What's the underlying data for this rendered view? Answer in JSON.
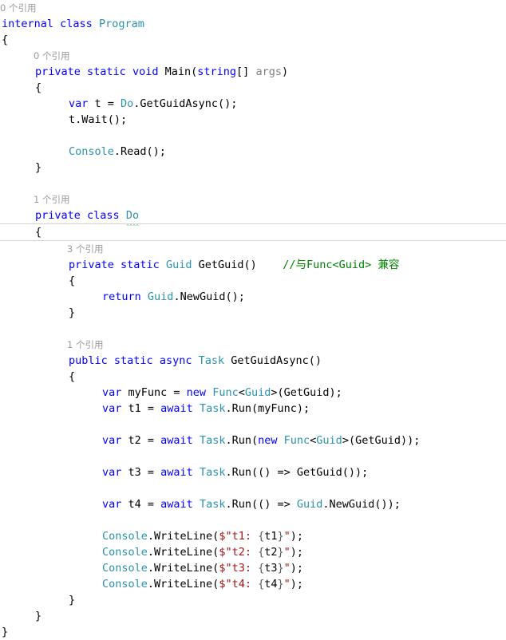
{
  "editor": {
    "language": "csharp",
    "theme": "light",
    "background": "#ffffff",
    "colors": {
      "keyword": "#0000ff",
      "type": "#2b91af",
      "comment": "#008000",
      "string": "#a31515",
      "parameter": "#808080",
      "codelens": "#9a9a9a",
      "squiggle": "#3bb371",
      "current_line_border": "#d4d4d4",
      "text": "#000000"
    }
  },
  "lines": [
    {
      "id": "l00",
      "kind": "clipped",
      "indent": 0,
      "tokens": [
        {
          "t": "0 个引用",
          "c": "codelens"
        }
      ]
    },
    {
      "id": "l01",
      "kind": "code",
      "indent": 0,
      "tokens": [
        {
          "t": "internal",
          "c": "kw"
        },
        {
          "t": " ",
          "c": "plain"
        },
        {
          "t": "class",
          "c": "kw"
        },
        {
          "t": " ",
          "c": "plain"
        },
        {
          "t": "Program",
          "c": "type"
        }
      ]
    },
    {
      "id": "l02",
      "kind": "code",
      "indent": 0,
      "tokens": [
        {
          "t": "{",
          "c": "plain"
        }
      ]
    },
    {
      "id": "l03",
      "kind": "codelens",
      "indent": 1,
      "tokens": [
        {
          "t": "0 个引用",
          "c": "codelens"
        }
      ]
    },
    {
      "id": "l04",
      "kind": "code",
      "indent": 1,
      "tokens": [
        {
          "t": "private",
          "c": "kw"
        },
        {
          "t": " ",
          "c": "plain"
        },
        {
          "t": "static",
          "c": "kw"
        },
        {
          "t": " ",
          "c": "plain"
        },
        {
          "t": "void",
          "c": "kw"
        },
        {
          "t": " Main(",
          "c": "plain"
        },
        {
          "t": "string",
          "c": "kw"
        },
        {
          "t": "[] ",
          "c": "plain"
        },
        {
          "t": "args",
          "c": "param"
        },
        {
          "t": ")",
          "c": "plain"
        }
      ]
    },
    {
      "id": "l05",
      "kind": "code",
      "indent": 1,
      "tokens": [
        {
          "t": "{",
          "c": "plain"
        }
      ]
    },
    {
      "id": "l06",
      "kind": "code",
      "indent": 2,
      "tokens": [
        {
          "t": "var",
          "c": "kw"
        },
        {
          "t": " t = ",
          "c": "plain"
        },
        {
          "t": "Do",
          "c": "type"
        },
        {
          "t": ".GetGuidAsync();",
          "c": "plain"
        }
      ]
    },
    {
      "id": "l07",
      "kind": "code",
      "indent": 2,
      "tokens": [
        {
          "t": "t.Wait();",
          "c": "plain"
        }
      ]
    },
    {
      "id": "l08",
      "kind": "code",
      "indent": 0,
      "tokens": []
    },
    {
      "id": "l09",
      "kind": "code",
      "indent": 2,
      "tokens": [
        {
          "t": "Console",
          "c": "type"
        },
        {
          "t": ".Read();",
          "c": "plain"
        }
      ]
    },
    {
      "id": "l10",
      "kind": "code",
      "indent": 1,
      "tokens": [
        {
          "t": "}",
          "c": "plain"
        }
      ]
    },
    {
      "id": "l11",
      "kind": "code",
      "indent": 0,
      "tokens": []
    },
    {
      "id": "l12",
      "kind": "codelens",
      "indent": 1,
      "tokens": [
        {
          "t": "1 个引用",
          "c": "codelens"
        }
      ]
    },
    {
      "id": "l13",
      "kind": "code",
      "indent": 1,
      "tokens": [
        {
          "t": "private",
          "c": "kw"
        },
        {
          "t": " ",
          "c": "plain"
        },
        {
          "t": "class",
          "c": "kw"
        },
        {
          "t": " ",
          "c": "plain"
        },
        {
          "t": "Do",
          "c": "type",
          "squiggle": true
        }
      ]
    },
    {
      "id": "l14",
      "kind": "current",
      "indent": 1,
      "tokens": [
        {
          "t": "{",
          "c": "plain"
        }
      ]
    },
    {
      "id": "l15",
      "kind": "codelens",
      "indent": 2,
      "tokens": [
        {
          "t": "3 个引用",
          "c": "codelens"
        }
      ]
    },
    {
      "id": "l16",
      "kind": "code",
      "indent": 2,
      "tokens": [
        {
          "t": "private",
          "c": "kw"
        },
        {
          "t": " ",
          "c": "plain"
        },
        {
          "t": "static",
          "c": "kw"
        },
        {
          "t": " ",
          "c": "plain"
        },
        {
          "t": "Guid",
          "c": "type"
        },
        {
          "t": " GetGuid()    ",
          "c": "plain"
        },
        {
          "t": "//与Func<Guid> 兼容",
          "c": "cmt"
        }
      ]
    },
    {
      "id": "l17",
      "kind": "code",
      "indent": 2,
      "tokens": [
        {
          "t": "{",
          "c": "plain"
        }
      ]
    },
    {
      "id": "l18",
      "kind": "code",
      "indent": 3,
      "tokens": [
        {
          "t": "return",
          "c": "kw"
        },
        {
          "t": " ",
          "c": "plain"
        },
        {
          "t": "Guid",
          "c": "type"
        },
        {
          "t": ".NewGuid();",
          "c": "plain"
        }
      ]
    },
    {
      "id": "l19",
      "kind": "code",
      "indent": 2,
      "tokens": [
        {
          "t": "}",
          "c": "plain"
        }
      ]
    },
    {
      "id": "l20",
      "kind": "code",
      "indent": 0,
      "tokens": []
    },
    {
      "id": "l21",
      "kind": "codelens",
      "indent": 2,
      "tokens": [
        {
          "t": "1 个引用",
          "c": "codelens"
        }
      ]
    },
    {
      "id": "l22",
      "kind": "code",
      "indent": 2,
      "tokens": [
        {
          "t": "public",
          "c": "kw"
        },
        {
          "t": " ",
          "c": "plain"
        },
        {
          "t": "static",
          "c": "kw"
        },
        {
          "t": " ",
          "c": "plain"
        },
        {
          "t": "async",
          "c": "kw"
        },
        {
          "t": " ",
          "c": "plain"
        },
        {
          "t": "Task",
          "c": "type"
        },
        {
          "t": " GetGuidAsync()",
          "c": "plain"
        }
      ]
    },
    {
      "id": "l23",
      "kind": "code",
      "indent": 2,
      "tokens": [
        {
          "t": "{",
          "c": "plain"
        }
      ]
    },
    {
      "id": "l24",
      "kind": "code",
      "indent": 3,
      "tokens": [
        {
          "t": "var",
          "c": "kw"
        },
        {
          "t": " myFunc = ",
          "c": "plain"
        },
        {
          "t": "new",
          "c": "kw"
        },
        {
          "t": " ",
          "c": "plain"
        },
        {
          "t": "Func",
          "c": "type"
        },
        {
          "t": "<",
          "c": "plain"
        },
        {
          "t": "Guid",
          "c": "type"
        },
        {
          "t": ">(GetGuid);",
          "c": "plain"
        }
      ]
    },
    {
      "id": "l25",
      "kind": "code",
      "indent": 3,
      "tokens": [
        {
          "t": "var",
          "c": "kw"
        },
        {
          "t": " t1 = ",
          "c": "plain"
        },
        {
          "t": "await",
          "c": "kw"
        },
        {
          "t": " ",
          "c": "plain"
        },
        {
          "t": "Task",
          "c": "type"
        },
        {
          "t": ".Run(myFunc);",
          "c": "plain"
        }
      ]
    },
    {
      "id": "l26",
      "kind": "code",
      "indent": 0,
      "tokens": []
    },
    {
      "id": "l27",
      "kind": "code",
      "indent": 3,
      "tokens": [
        {
          "t": "var",
          "c": "kw"
        },
        {
          "t": " t2 = ",
          "c": "plain"
        },
        {
          "t": "await",
          "c": "kw"
        },
        {
          "t": " ",
          "c": "plain"
        },
        {
          "t": "Task",
          "c": "type"
        },
        {
          "t": ".Run(",
          "c": "plain"
        },
        {
          "t": "new",
          "c": "kw"
        },
        {
          "t": " ",
          "c": "plain"
        },
        {
          "t": "Func",
          "c": "type"
        },
        {
          "t": "<",
          "c": "plain"
        },
        {
          "t": "Guid",
          "c": "type"
        },
        {
          "t": ">(GetGuid));",
          "c": "plain"
        }
      ]
    },
    {
      "id": "l28",
      "kind": "code",
      "indent": 0,
      "tokens": []
    },
    {
      "id": "l29",
      "kind": "code",
      "indent": 3,
      "tokens": [
        {
          "t": "var",
          "c": "kw"
        },
        {
          "t": " t3 = ",
          "c": "plain"
        },
        {
          "t": "await",
          "c": "kw"
        },
        {
          "t": " ",
          "c": "plain"
        },
        {
          "t": "Task",
          "c": "type"
        },
        {
          "t": ".Run(() => GetGuid());",
          "c": "plain"
        }
      ]
    },
    {
      "id": "l30",
      "kind": "code",
      "indent": 0,
      "tokens": []
    },
    {
      "id": "l31",
      "kind": "code",
      "indent": 3,
      "tokens": [
        {
          "t": "var",
          "c": "kw"
        },
        {
          "t": " t4 = ",
          "c": "plain"
        },
        {
          "t": "await",
          "c": "kw"
        },
        {
          "t": " ",
          "c": "plain"
        },
        {
          "t": "Task",
          "c": "type"
        },
        {
          "t": ".Run(() => ",
          "c": "plain"
        },
        {
          "t": "Guid",
          "c": "type"
        },
        {
          "t": ".NewGuid());",
          "c": "plain"
        }
      ]
    },
    {
      "id": "l32",
      "kind": "code",
      "indent": 0,
      "tokens": []
    },
    {
      "id": "l33",
      "kind": "code",
      "indent": 3,
      "tokens": [
        {
          "t": "Console",
          "c": "type"
        },
        {
          "t": ".WriteLine(",
          "c": "plain"
        },
        {
          "t": "$\"",
          "c": "strp"
        },
        {
          "t": "t1: ",
          "c": "str"
        },
        {
          "t": "{",
          "c": "ibrace"
        },
        {
          "t": "t1",
          "c": "plain"
        },
        {
          "t": "}",
          "c": "ibrace"
        },
        {
          "t": "\"",
          "c": "strp"
        },
        {
          "t": ");",
          "c": "plain"
        }
      ]
    },
    {
      "id": "l34",
      "kind": "code",
      "indent": 3,
      "tokens": [
        {
          "t": "Console",
          "c": "type"
        },
        {
          "t": ".WriteLine(",
          "c": "plain"
        },
        {
          "t": "$\"",
          "c": "strp"
        },
        {
          "t": "t2: ",
          "c": "str"
        },
        {
          "t": "{",
          "c": "ibrace"
        },
        {
          "t": "t2",
          "c": "plain"
        },
        {
          "t": "}",
          "c": "ibrace"
        },
        {
          "t": "\"",
          "c": "strp"
        },
        {
          "t": ");",
          "c": "plain"
        }
      ]
    },
    {
      "id": "l35",
      "kind": "code",
      "indent": 3,
      "tokens": [
        {
          "t": "Console",
          "c": "type"
        },
        {
          "t": ".WriteLine(",
          "c": "plain"
        },
        {
          "t": "$\"",
          "c": "strp"
        },
        {
          "t": "t3: ",
          "c": "str"
        },
        {
          "t": "{",
          "c": "ibrace"
        },
        {
          "t": "t3",
          "c": "plain"
        },
        {
          "t": "}",
          "c": "ibrace"
        },
        {
          "t": "\"",
          "c": "strp"
        },
        {
          "t": ");",
          "c": "plain"
        }
      ]
    },
    {
      "id": "l36",
      "kind": "code",
      "indent": 3,
      "tokens": [
        {
          "t": "Console",
          "c": "type"
        },
        {
          "t": ".WriteLine(",
          "c": "plain"
        },
        {
          "t": "$\"",
          "c": "strp"
        },
        {
          "t": "t4: ",
          "c": "str"
        },
        {
          "t": "{",
          "c": "ibrace"
        },
        {
          "t": "t4",
          "c": "plain"
        },
        {
          "t": "}",
          "c": "ibrace"
        },
        {
          "t": "\"",
          "c": "strp"
        },
        {
          "t": ");",
          "c": "plain"
        }
      ]
    },
    {
      "id": "l37",
      "kind": "code",
      "indent": 2,
      "tokens": [
        {
          "t": "}",
          "c": "plain"
        }
      ]
    },
    {
      "id": "l38",
      "kind": "code",
      "indent": 1,
      "tokens": [
        {
          "t": "}",
          "c": "plain"
        }
      ]
    },
    {
      "id": "l39",
      "kind": "code",
      "indent": 0,
      "tokens": [
        {
          "t": "}",
          "c": "plain"
        }
      ]
    }
  ]
}
